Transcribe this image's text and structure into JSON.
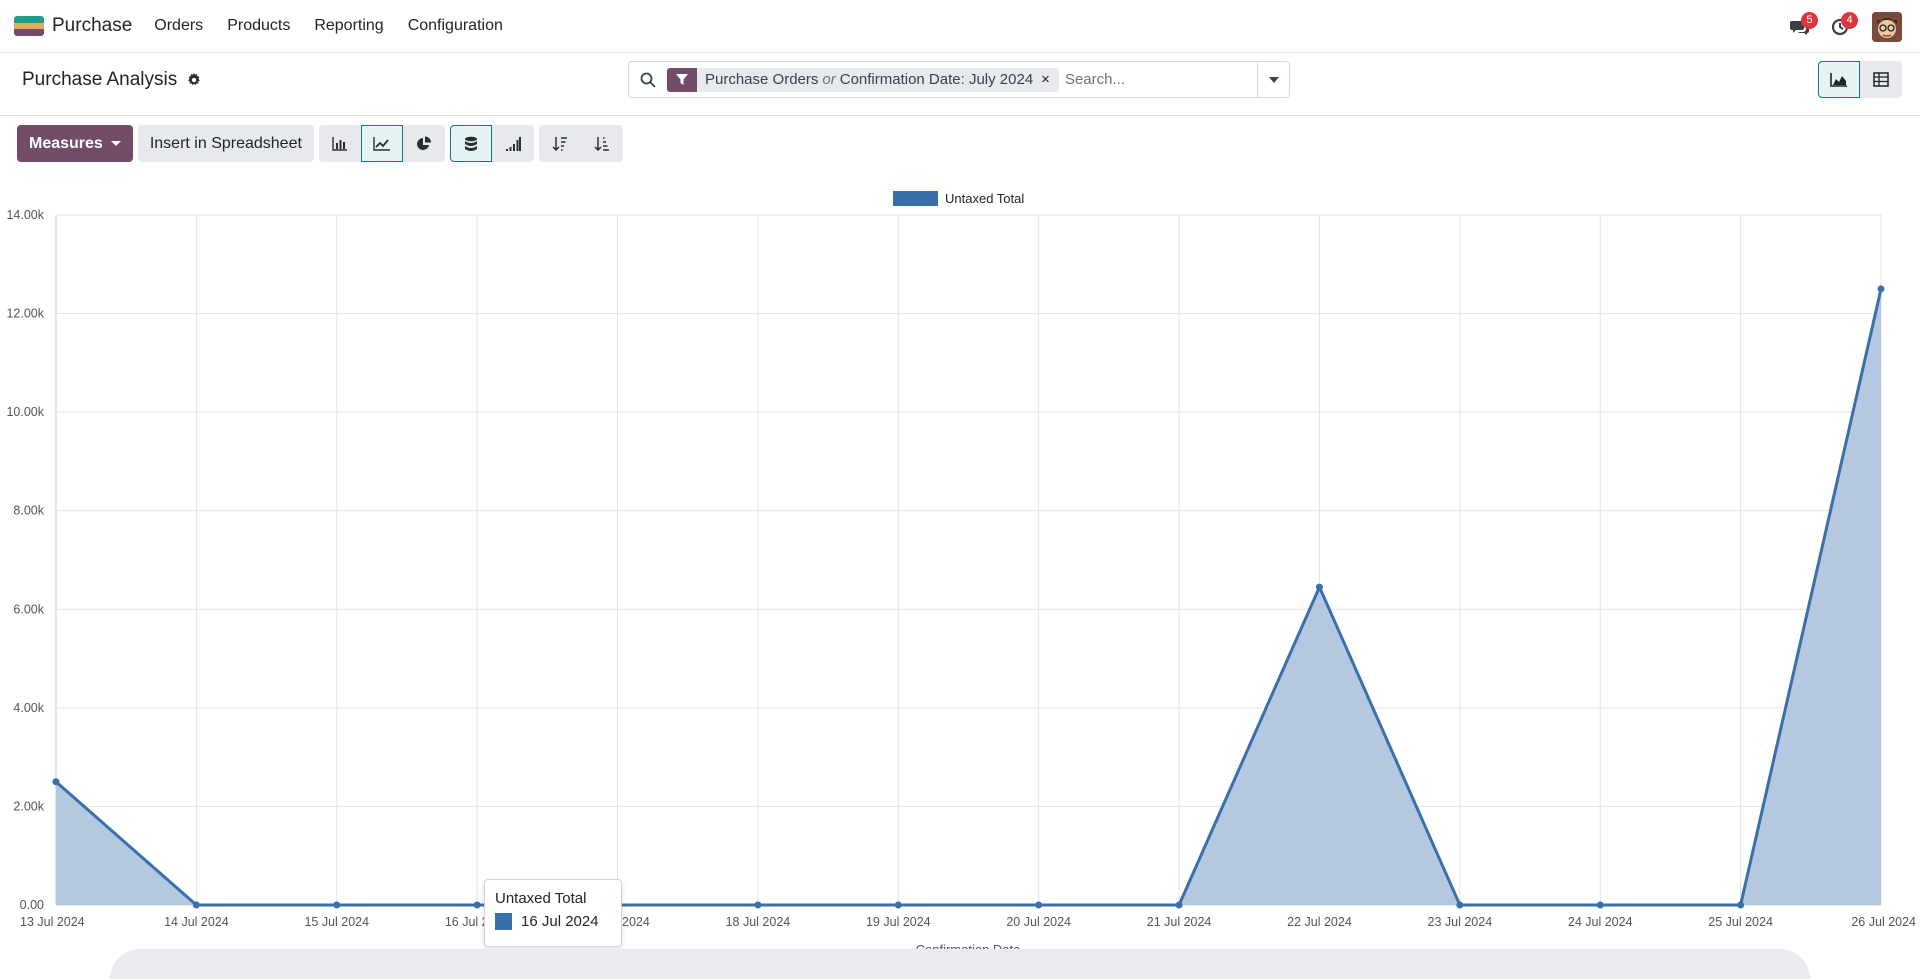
{
  "navbar": {
    "app_name": "Purchase",
    "menu": [
      "Orders",
      "Products",
      "Reporting",
      "Configuration"
    ],
    "messages_count": "5",
    "activities_count": "4",
    "logo_colors": [
      "#1f9c8c",
      "#e6a95b",
      "#714b67"
    ]
  },
  "control_panel": {
    "title": "Purchase Analysis",
    "facet": {
      "field": "Purchase Orders",
      "or": "or",
      "value": "Confirmation Date: July 2024"
    },
    "search_placeholder": "Search...",
    "close_symbol": "×"
  },
  "toolbar": {
    "measures_label": "Measures",
    "insert_label": "Insert in Spreadsheet",
    "chart_type_buttons": [
      "bar-chart-icon",
      "line-chart-icon",
      "pie-chart-icon"
    ],
    "active_chart_type": "line-chart-icon",
    "option_buttons": [
      "stacked-icon",
      "cumulative-icon"
    ],
    "sort_buttons": [
      "sort-descending-icon",
      "sort-ascending-icon"
    ]
  },
  "tooltip": {
    "title": "Untaxed Total",
    "label": "16 Jul 2024"
  },
  "colors": {
    "accent": "#714b67",
    "series": "#3a6fad",
    "fill": "#b0c6de",
    "active_border": "#017e84"
  },
  "chart_data": {
    "type": "area",
    "categories": [
      "13 Jul 2024",
      "14 Jul 2024",
      "15 Jul 2024",
      "16 Jul 2024",
      "17 Jul 2024",
      "18 Jul 2024",
      "19 Jul 2024",
      "20 Jul 2024",
      "21 Jul 2024",
      "22 Jul 2024",
      "23 Jul 2024",
      "24 Jul 2024",
      "25 Jul 2024",
      "26 Jul 2024"
    ],
    "series": [
      {
        "name": "Untaxed Total",
        "values": [
          2500,
          0,
          0,
          0,
          0,
          0,
          0,
          0,
          0,
          6450,
          0,
          0,
          0,
          12500
        ]
      }
    ],
    "xlabel": "Confirmation Date",
    "ylabel": "",
    "ylim": [
      0,
      14000
    ],
    "yticks": [
      "0.00",
      "2.00k",
      "4.00k",
      "6.00k",
      "8.00k",
      "10.00k",
      "12.00k",
      "14.00k"
    ],
    "grid": true,
    "legend": "top-center"
  }
}
